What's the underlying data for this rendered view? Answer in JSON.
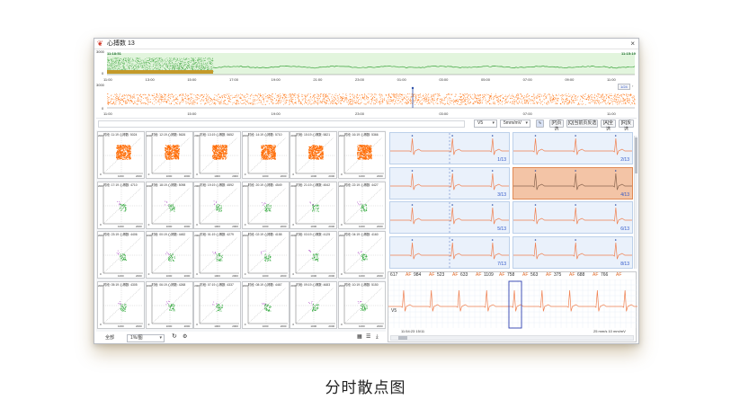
{
  "window": {
    "title": "心搏数 13",
    "close_glyph": "×",
    "app_icon": "heart-rate-app-icon"
  },
  "trend_chart": {
    "start_time": "11:18:51",
    "end_time": "11:15:19",
    "y_top": "3000",
    "y_bottom": "0"
  },
  "rr_chart": {
    "y_top": "3000",
    "y_bottom": "0",
    "page_indicator": "1/24"
  },
  "time_axis": {
    "top_ticks": [
      "11:00",
      "13:00",
      "15:00",
      "17:00",
      "19:00",
      "21:00",
      "23:00",
      "01:00",
      "03:00",
      "05:00",
      "07:00",
      "09:00",
      "11:00"
    ],
    "bottom_ticks": [
      "11:00",
      "15:00",
      "19:00",
      "23:00",
      "03:00",
      "07:00",
      "11:00"
    ]
  },
  "toolbar": {
    "lead_select": "V5",
    "gain_select": "5mm/mV",
    "button_1": "[P]页选",
    "button_2": "[Q]当前页反选",
    "button_3": "[A]全选",
    "button_4": "[R]反选"
  },
  "scatter": {
    "axis_max": "2000",
    "axis_mid": "1000",
    "axis_zero": "0",
    "cells": [
      {
        "header": "时段: 11:19 心搏数: 5024"
      },
      {
        "header": "时段: 12:19 心搏数: 5626"
      },
      {
        "header": "时段: 13:19 心搏数: 5652"
      },
      {
        "header": "时段: 14:19 心搏数: 5710"
      },
      {
        "header": "时段: 15:19 心搏数: 5821"
      },
      {
        "header": "时段: 16:19 心搏数: 5366"
      },
      {
        "header": "时段: 17:19 心搏数: 4710"
      },
      {
        "header": "时段: 18:19 心搏数: 5098"
      },
      {
        "header": "时段: 19:19 心搏数: 4592"
      },
      {
        "header": "时段: 20:19 心搏数: 4549"
      },
      {
        "header": "时段: 21:19 心搏数: 4542"
      },
      {
        "header": "时段: 22:19 心搏数: 4427"
      },
      {
        "header": "时段: 23:19 心搏数: 4406"
      },
      {
        "header": "时段: 00:19 心搏数: 4482"
      },
      {
        "header": "时段: 01:19 心搏数: 4279"
      },
      {
        "header": "时段: 02:19 心搏数: 4158"
      },
      {
        "header": "时段: 03:19 心搏数: 4125"
      },
      {
        "header": "时段: 04:19 心搏数: 4160"
      },
      {
        "header": "时段: 05:19 心搏数: 4305"
      },
      {
        "header": "时段: 06:19 心搏数: 4268"
      },
      {
        "header": "时段: 07:19 心搏数: 4337"
      },
      {
        "header": "时段: 08:19 心搏数: 4467"
      },
      {
        "header": "时段: 09:19 心搏数: 4683"
      },
      {
        "header": "时段: 10:19 心搏数: 5150"
      }
    ]
  },
  "bottom_bar": {
    "filter_label": "全部",
    "page_select": "1%/图",
    "refresh_icon": "refresh-icon",
    "settings_icon": "gear-icon"
  },
  "ecg_grid": {
    "cells": [
      {
        "label": "1/13",
        "selected": false
      },
      {
        "label": "2/13",
        "selected": false
      },
      {
        "label": "3/13",
        "selected": false
      },
      {
        "label": "4/13",
        "selected": true
      },
      {
        "label": "5/13",
        "selected": false
      },
      {
        "label": "6/13",
        "selected": false
      },
      {
        "label": "7/13",
        "selected": false
      },
      {
        "label": "8/13",
        "selected": false
      }
    ]
  },
  "rhythm_strip": {
    "annotations": [
      "617",
      "AF",
      "984",
      "AF",
      "523",
      "AF",
      "633",
      "AF",
      "1109",
      "AF",
      "758",
      "AF",
      "563",
      "AF",
      "375",
      "AF",
      "688",
      "AF",
      "766",
      "AF"
    ],
    "lead": "V5",
    "timestamp": "11:54:23 15/11",
    "speed": "25 mm/s 10 mm/mV"
  },
  "caption": "分时散点图",
  "colors": {
    "trend_green": "#3aa33a",
    "scatter_orange": "#ff6a00",
    "scatter_green": "#2fa83a",
    "ecg_line": "#f08050",
    "selected_cell": "#f3c4a6",
    "label_blue": "#2c55c9"
  }
}
